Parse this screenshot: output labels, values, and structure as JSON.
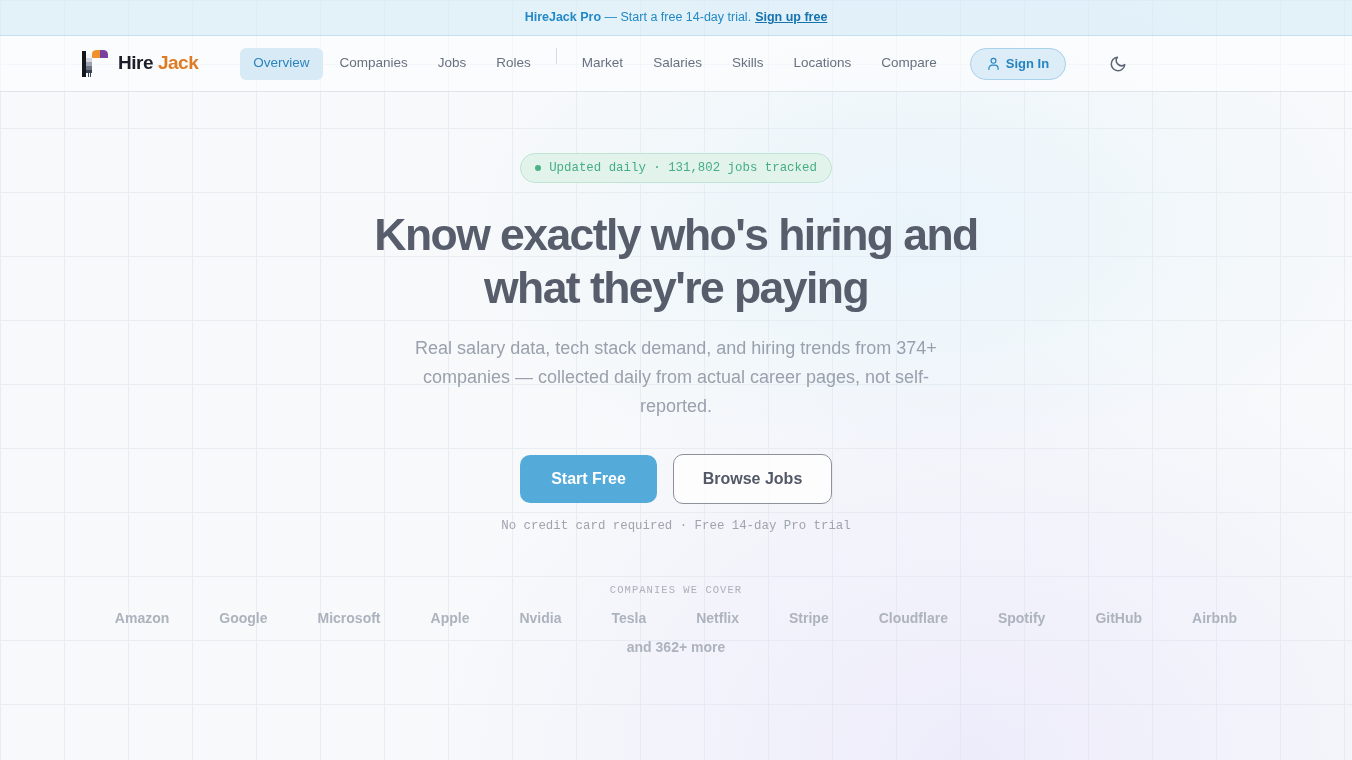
{
  "banner": {
    "text": "**HireJack Pro** — Start a free 14-day trial.",
    "link": "Sign up free"
  },
  "header": {
    "brand": {
      "first": "Hire",
      "second": "Jack"
    },
    "nav_groups": [
      {
        "items": [
          {
            "label": "Overview",
            "selected": true
          },
          {
            "label": "Companies",
            "selected": false
          },
          {
            "label": "Jobs",
            "selected": false
          },
          {
            "label": "Roles",
            "selected": false
          }
        ]
      },
      {
        "items": [
          {
            "label": "Market",
            "selected": false
          },
          {
            "label": "Salaries",
            "selected": false
          },
          {
            "label": "Skills",
            "selected": false
          },
          {
            "label": "Locations",
            "selected": false
          },
          {
            "label": "Compare",
            "selected": false
          }
        ]
      }
    ],
    "sign_in": "Sign In"
  },
  "hero": {
    "badge": "Updated daily · 131,802 jobs tracked",
    "heading": "Know exactly who's hiring and what they're paying",
    "subtitle": "Real salary data, tech stack demand, and hiring trends from 374+ companies — collected daily from actual career pages, not self-reported.",
    "buttons": [
      {
        "label": "Start Free",
        "kind": "primary"
      },
      {
        "label": "Browse Jobs",
        "kind": "secondary"
      }
    ],
    "note": "No credit card required · Free 14-day Pro trial"
  },
  "companies": {
    "label": "COMPANIES WE COVER",
    "names": [
      "Amazon",
      "Google",
      "Microsoft",
      "Apple",
      "Nvidia",
      "Tesla",
      "Netflix",
      "Stripe",
      "Cloudflare",
      "Spotify",
      "GitHub",
      "Airbnb"
    ],
    "more": "and 362+ more"
  }
}
